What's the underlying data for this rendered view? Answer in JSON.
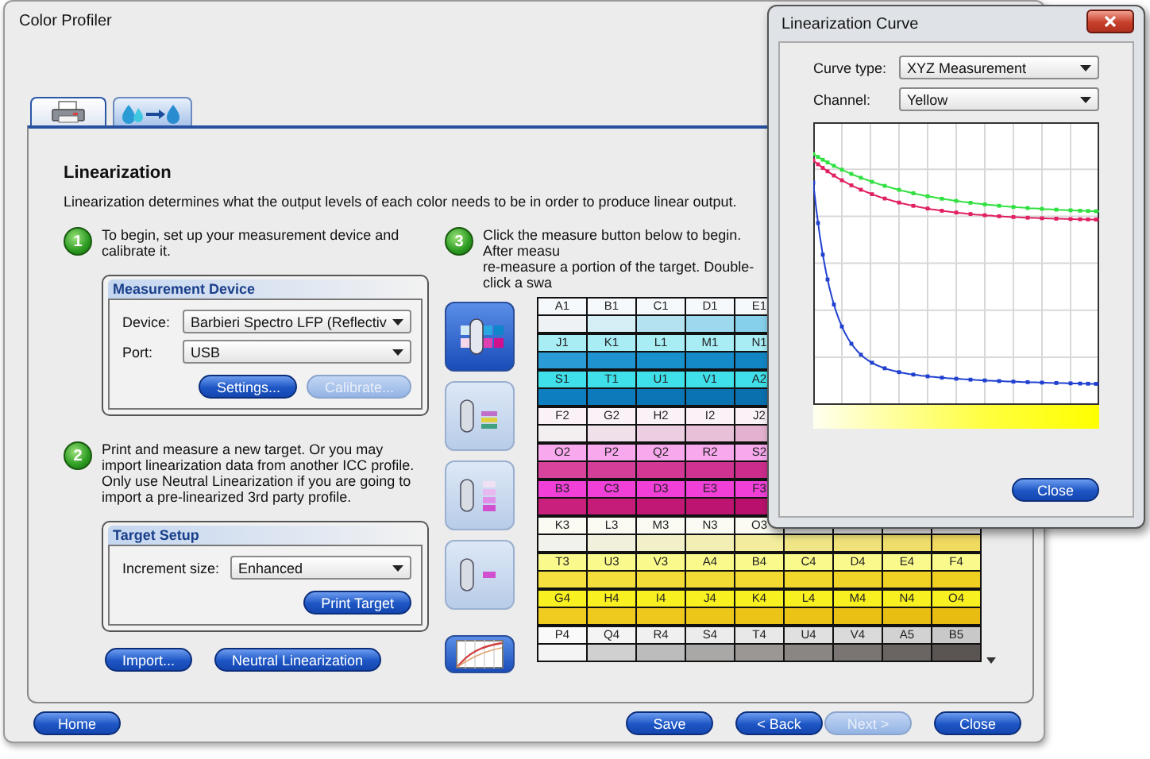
{
  "window": {
    "title": "Color Profiler"
  },
  "tabs": [
    {
      "kind": "printer",
      "selected": true
    },
    {
      "kind": "ink-flow",
      "selected": false
    }
  ],
  "section": {
    "title": "Linearization",
    "description": "Linearization determines what the output levels of each color needs to be in order to produce linear output."
  },
  "steps": [
    {
      "number": "1",
      "lines": [
        "To begin, set up your measurement device and calibrate it."
      ]
    },
    {
      "number": "2",
      "lines": [
        "Print and measure a new target. Or you may import linearization data from another ICC profile. Only use Neutral Linearization if you are going to import a pre-linearized 3rd party profile."
      ]
    },
    {
      "number": "3",
      "lines": [
        "Click the measure button below to begin. After measu",
        "re-measure a portion of the target. Double-click a swa"
      ]
    }
  ],
  "measurement_device": {
    "title": "Measurement Device",
    "fields": [
      {
        "label": "Device:",
        "value": "Barbieri Spectro LFP (Reflectiv"
      },
      {
        "label": "Port:",
        "value": "USB"
      }
    ],
    "buttons": [
      {
        "label": "Settings...",
        "disabled": false
      },
      {
        "label": "Calibrate...",
        "disabled": true
      }
    ]
  },
  "target_setup": {
    "title": "Target Setup",
    "field": {
      "label": "Increment size:",
      "value": "Enhanced"
    },
    "button": {
      "label": "Print Target",
      "disabled": false
    }
  },
  "left_buttons": [
    {
      "label": "Import...",
      "disabled": false
    },
    {
      "label": "Neutral Linearization",
      "disabled": false
    }
  ],
  "tool_buttons": [
    {
      "kind": "strip",
      "disabled": false
    },
    {
      "kind": "column",
      "disabled": true
    },
    {
      "kind": "patches",
      "disabled": true
    },
    {
      "kind": "spot",
      "disabled": true
    },
    {
      "kind": "chart",
      "disabled": false
    }
  ],
  "target_grid": {
    "groups": [
      {
        "labels": [
          {
            "label": "A1",
            "color": "#f6f9fb"
          },
          {
            "label": "B1",
            "color": "#f6f9fb"
          },
          {
            "label": "C1",
            "color": "#f6f9fb"
          },
          {
            "label": "D1",
            "color": "#f6f9fb"
          },
          {
            "label": "E1",
            "color": "#f6f9fb"
          }
        ],
        "swatches": [
          {
            "color": "#eef2f5"
          },
          {
            "color": "#d6eef5"
          },
          {
            "color": "#b4e2f0"
          },
          {
            "color": "#9cd8ee"
          },
          {
            "color": "#86d0ec"
          }
        ]
      },
      {
        "labels": [
          {
            "label": "J1",
            "color": "#a8ecf4"
          },
          {
            "label": "K1",
            "color": "#a8ecf4"
          },
          {
            "label": "L1",
            "color": "#a8ecf4"
          },
          {
            "label": "M1",
            "color": "#a8ecf4"
          },
          {
            "label": "N1",
            "color": "#a8ecf4"
          }
        ],
        "swatches": [
          {
            "color": "#2a9bd4"
          },
          {
            "color": "#1e93d0"
          },
          {
            "color": "#1890cc"
          },
          {
            "color": "#148ac8"
          },
          {
            "color": "#1286c4"
          }
        ]
      },
      {
        "labels": [
          {
            "label": "S1",
            "color": "#40e0ea"
          },
          {
            "label": "T1",
            "color": "#40e0ea"
          },
          {
            "label": "U1",
            "color": "#40e0ea"
          },
          {
            "label": "V1",
            "color": "#40e0ea"
          },
          {
            "label": "A2",
            "color": "#40e0ea"
          }
        ],
        "swatches": [
          {
            "color": "#0d7fc0"
          },
          {
            "color": "#0c7abb"
          },
          {
            "color": "#0a76b6"
          },
          {
            "color": "#0a73b2"
          },
          {
            "color": "#0a70ae"
          }
        ]
      },
      {
        "labels": [
          {
            "label": "F2",
            "color": "#fbf2f7"
          },
          {
            "label": "G2",
            "color": "#fbf2f7"
          },
          {
            "label": "H2",
            "color": "#fbf2f7"
          },
          {
            "label": "I2",
            "color": "#fbf2f7"
          },
          {
            "label": "J2",
            "color": "#fbf2f7"
          }
        ],
        "swatches": [
          {
            "color": "#f3eef0"
          },
          {
            "color": "#efe0ea"
          },
          {
            "color": "#ebcfe0"
          },
          {
            "color": "#e8c0d8"
          },
          {
            "color": "#e4b2d0"
          }
        ]
      },
      {
        "labels": [
          {
            "label": "O2",
            "color": "#f8a8ec"
          },
          {
            "label": "P2",
            "color": "#f8a8ec"
          },
          {
            "label": "Q2",
            "color": "#f8a8ec"
          },
          {
            "label": "R2",
            "color": "#f8a8ec"
          },
          {
            "label": "S2",
            "color": "#f8a8ec"
          }
        ],
        "swatches": [
          {
            "color": "#d8449c"
          },
          {
            "color": "#d53e98"
          },
          {
            "color": "#d23894"
          },
          {
            "color": "#cf3290"
          },
          {
            "color": "#cc2c8c"
          }
        ]
      },
      {
        "labels": [
          {
            "label": "B3",
            "color": "#f040d8"
          },
          {
            "label": "C3",
            "color": "#f040d8"
          },
          {
            "label": "D3",
            "color": "#f040d8"
          },
          {
            "label": "E3",
            "color": "#f040d8"
          },
          {
            "label": "F3",
            "color": "#f040d8"
          }
        ],
        "swatches": [
          {
            "color": "#c8207c"
          },
          {
            "color": "#c41c78"
          },
          {
            "color": "#c01874"
          },
          {
            "color": "#bc1470"
          },
          {
            "color": "#b8106c"
          }
        ]
      },
      {
        "labels": [
          {
            "label": "K3",
            "color": "#fbfbf4"
          },
          {
            "label": "L3",
            "color": "#fbfbf4"
          },
          {
            "label": "M3",
            "color": "#fbfbf4"
          },
          {
            "label": "N3",
            "color": "#fbfbf4"
          },
          {
            "label": "O3",
            "color": "#fbfbf4"
          }
        ],
        "swatches": [
          {
            "color": "#f2f2ec"
          },
          {
            "color": "#f0f0dc"
          },
          {
            "color": "#f2f0c8"
          },
          {
            "color": "#f2eeb4"
          },
          {
            "color": "#f2ec9c"
          },
          {
            "color": "#f0e688"
          },
          {
            "color": "#f0e27a"
          },
          {
            "color": "#f0de6c"
          },
          {
            "color": "#f0da60"
          }
        ]
      },
      {
        "labels": [
          {
            "label": "T3",
            "color": "#fafa8c"
          },
          {
            "label": "U3",
            "color": "#fafa8c"
          },
          {
            "label": "V3",
            "color": "#fafa8c"
          },
          {
            "label": "A4",
            "color": "#fafa8c"
          },
          {
            "label": "B4",
            "color": "#fafa8c"
          },
          {
            "label": "C4",
            "color": "#fafa8c"
          },
          {
            "label": "D4",
            "color": "#fafa8c"
          },
          {
            "label": "E4",
            "color": "#fafa8c"
          },
          {
            "label": "F4",
            "color": "#fafa8c"
          }
        ],
        "swatches": [
          {
            "color": "#f5e040"
          },
          {
            "color": "#f4de3c"
          },
          {
            "color": "#f3dc38"
          },
          {
            "color": "#f2da34"
          },
          {
            "color": "#f2d830"
          },
          {
            "color": "#f1d62c"
          },
          {
            "color": "#f0d428"
          },
          {
            "color": "#f0d224"
          },
          {
            "color": "#efd020"
          }
        ]
      },
      {
        "labels": [
          {
            "label": "G4",
            "color": "#f8f020"
          },
          {
            "label": "H4",
            "color": "#f8f020"
          },
          {
            "label": "I4",
            "color": "#f8f020"
          },
          {
            "label": "J4",
            "color": "#f8f020"
          },
          {
            "label": "K4",
            "color": "#f8f020"
          },
          {
            "label": "L4",
            "color": "#f8f020"
          },
          {
            "label": "M4",
            "color": "#f8f020"
          },
          {
            "label": "N4",
            "color": "#f8f020"
          },
          {
            "label": "O4",
            "color": "#f8f020"
          }
        ],
        "swatches": [
          {
            "color": "#f0cc20"
          },
          {
            "color": "#efca1e"
          },
          {
            "color": "#eec81c"
          },
          {
            "color": "#edc61a"
          },
          {
            "color": "#ecc418"
          },
          {
            "color": "#ebc216"
          },
          {
            "color": "#eac014"
          },
          {
            "color": "#e9be12"
          },
          {
            "color": "#e8bc10"
          }
        ]
      },
      {
        "labels": [
          {
            "label": "P4",
            "color": "#fafafa"
          },
          {
            "label": "Q4",
            "color": "#f4f4f4"
          },
          {
            "label": "R4",
            "color": "#f0f0f0"
          },
          {
            "label": "S4",
            "color": "#ececec"
          },
          {
            "label": "T4",
            "color": "#e8e8e8"
          },
          {
            "label": "U4",
            "color": "#e0e0e0"
          },
          {
            "label": "V4",
            "color": "#dadada"
          },
          {
            "label": "A5",
            "color": "#d2d2d2"
          },
          {
            "label": "B5",
            "color": "#c8c8c8"
          }
        ],
        "swatches": [
          {
            "color": "#f4f4f4"
          },
          {
            "color": "#d0d0d0"
          },
          {
            "color": "#bcbcbc"
          },
          {
            "color": "#aaa8a6"
          },
          {
            "color": "#9a9794"
          },
          {
            "color": "#8a8683"
          },
          {
            "color": "#7a7572"
          },
          {
            "color": "#6a6562"
          },
          {
            "color": "#5a5552"
          }
        ]
      }
    ]
  },
  "home_button": {
    "label": "Home",
    "disabled": false
  },
  "nav_buttons": [
    {
      "label": "Save",
      "disabled": false
    },
    {
      "label": "< Back",
      "disabled": false
    },
    {
      "label": "Next >",
      "disabled": true
    },
    {
      "label": "Close",
      "disabled": false
    }
  ],
  "curve_dialog": {
    "title": "Linearization Curve",
    "fields": [
      {
        "label": "Curve type:",
        "value": "XYZ Measurement"
      },
      {
        "label": "Channel:",
        "value": "Yellow"
      }
    ],
    "close_button": {
      "label": "Close",
      "disabled": false
    }
  }
}
